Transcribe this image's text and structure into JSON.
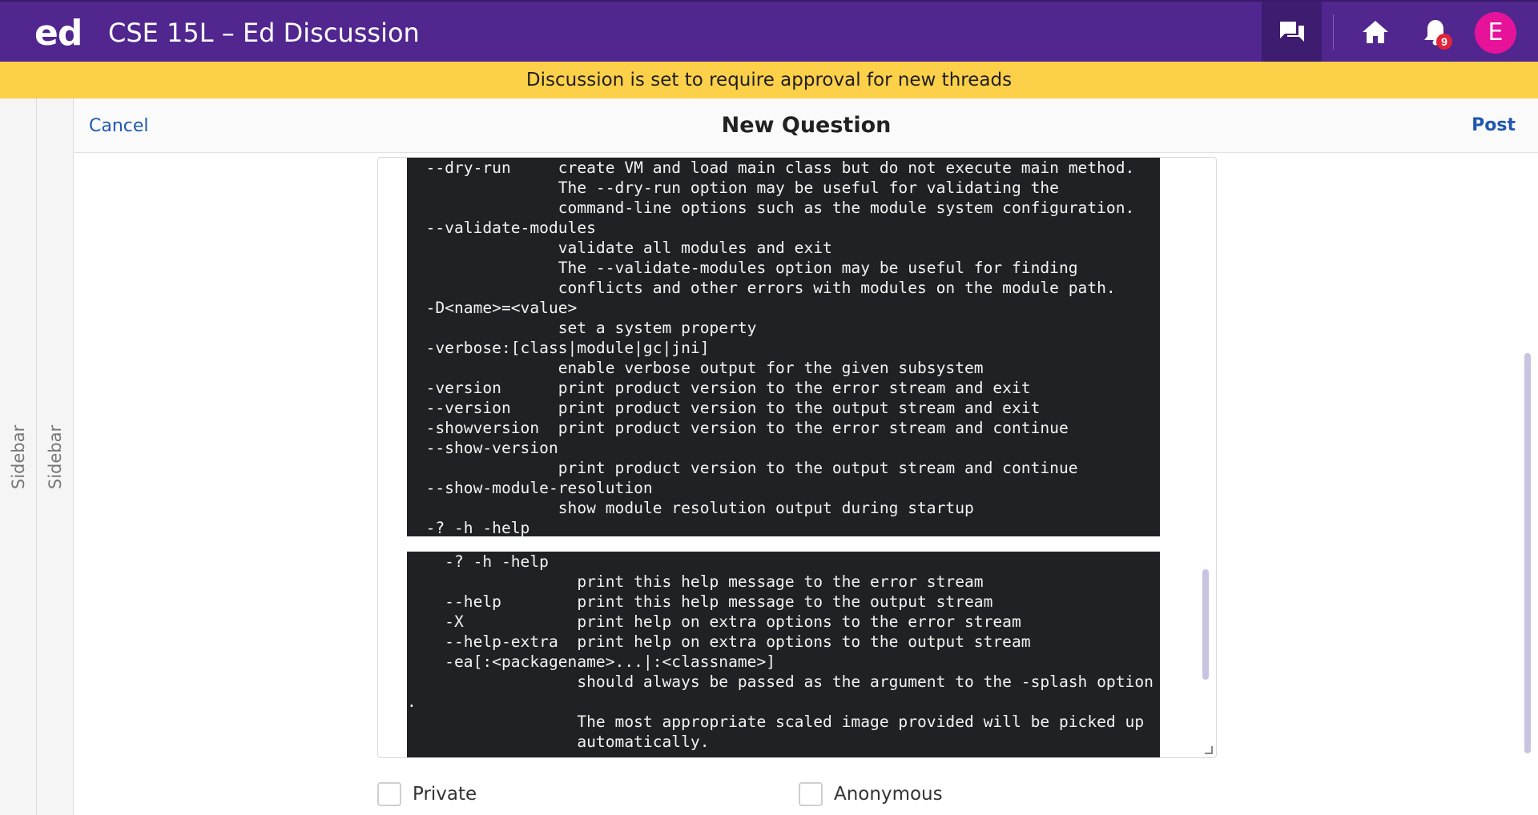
{
  "header": {
    "logo": "ed",
    "course_title": "CSE 15L – Ed Discussion",
    "notification_count": "9",
    "avatar_initial": "E",
    "icons": [
      "discussion-icon",
      "home-icon",
      "bell-icon"
    ]
  },
  "banner": {
    "text": "Discussion is set to require approval for new threads"
  },
  "sidebars": [
    {
      "label": "Sidebar"
    },
    {
      "label": "Sidebar"
    }
  ],
  "compose": {
    "cancel_label": "Cancel",
    "title": "New Question",
    "post_label": "Post"
  },
  "code_block_1": [
    "  --dry-run     create VM and load main class but do not execute main method.",
    "                The --dry-run option may be useful for validating the",
    "                command-line options such as the module system configuration.",
    "  --validate-modules",
    "                validate all modules and exit",
    "                The --validate-modules option may be useful for finding",
    "                conflicts and other errors with modules on the module path.",
    "  -D<name>=<value>",
    "                set a system property",
    "  -verbose:[class|module|gc|jni]",
    "                enable verbose output for the given subsystem",
    "  -version      print product version to the error stream and exit",
    "  --version     print product version to the output stream and exit",
    "  -showversion  print product version to the error stream and continue",
    "  --show-version",
    "                print product version to the output stream and continue",
    "  --show-module-resolution",
    "                show module resolution output during startup",
    "  -? -h -help"
  ],
  "code_block_2": [
    "    -? -h -help",
    "                  print this help message to the error stream",
    "    --help        print this help message to the output stream",
    "    -X            print help on extra options to the error stream",
    "    --help-extra  print help on extra options to the output stream",
    "    -ea[:<packagename>...|:<classname>]",
    "                  should always be passed as the argument to the -splash option",
    ".",
    "                  The most appropriate scaled image provided will be picked up",
    "                  automatically."
  ],
  "options": {
    "private_label": "Private",
    "anonymous_label": "Anonymous"
  },
  "colors": {
    "header": "#51268f",
    "banner": "#fdd04a",
    "avatar": "#e6139a",
    "link": "#1f58b0",
    "code_bg": "#202124"
  }
}
